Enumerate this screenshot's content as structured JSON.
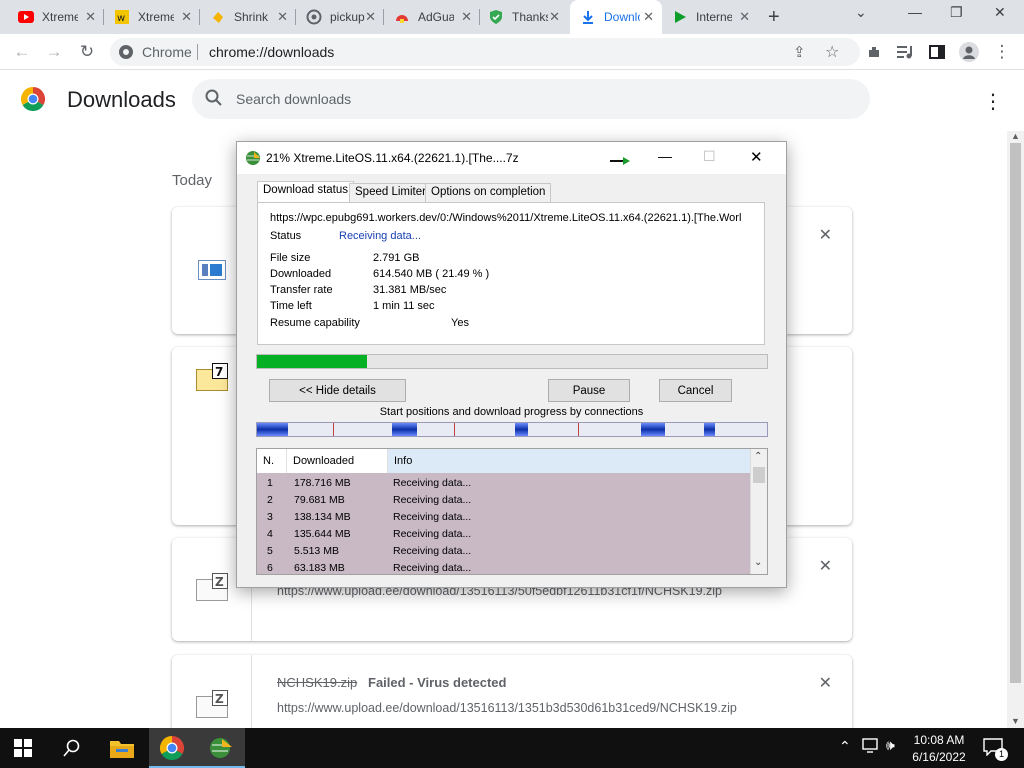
{
  "browser": {
    "tabs": [
      {
        "title": "Xtreme",
        "favicon": "youtube-icon"
      },
      {
        "title": "Xtreme",
        "favicon": "site-icon"
      },
      {
        "title": "Shrink",
        "favicon": "hand-icon"
      },
      {
        "title": "pickup",
        "favicon": "globe-icon"
      },
      {
        "title": "AdGuard",
        "favicon": "adguard-icon"
      },
      {
        "title": "Thanks",
        "favicon": "shield-check-icon"
      },
      {
        "title": "Downloads",
        "favicon": "download-icon",
        "active": true
      },
      {
        "title": "Internet",
        "favicon": "play-icon"
      }
    ],
    "omnibox": {
      "chip": "Chrome",
      "url": "chrome://downloads"
    }
  },
  "downloads_page": {
    "title": "Downloads",
    "search_placeholder": "Search downloads",
    "section": "Today",
    "items": [
      {
        "name": "",
        "status": "",
        "url": ""
      },
      {
        "name": "",
        "status": "",
        "url": ""
      },
      {
        "name": "",
        "status": "",
        "url": "https://www.upload.ee/download/13516113/50f5edbf12611b31cf1f/NCHSK19.zip"
      },
      {
        "name": "NCHSK19.zip",
        "status": "Failed - Virus detected",
        "url": "https://www.upload.ee/download/13516113/1351b3d530d61b31ced9/NCHSK19.zip"
      }
    ]
  },
  "idm": {
    "title": "21% Xtreme.LiteOS.11.x64.(22621.1).[The....7z",
    "tabs": [
      "Download status",
      "Speed Limiter",
      "Options on completion"
    ],
    "url": "https://wpc.epubg691.workers.dev/0:/Windows%2011/Xtreme.LiteOS.11.x64.(22621.1).[The.Worl",
    "status_label": "Status",
    "status_value": "Receiving data...",
    "fields": [
      {
        "label": "File size",
        "value": "2.791  GB"
      },
      {
        "label": "Downloaded",
        "value": "614.540  MB  ( 21.49 % )"
      },
      {
        "label": "Transfer rate",
        "value": "31.381  MB/sec"
      },
      {
        "label": "Time left",
        "value": "1 min 11 sec"
      },
      {
        "label": "Resume capability",
        "value": "Yes"
      }
    ],
    "progress": 0.2149,
    "buttons": {
      "hide": "<< Hide details",
      "pause": "Pause",
      "cancel": "Cancel"
    },
    "connections_label": "Start positions and download progress by connections",
    "table_headers": [
      "N.",
      "Downloaded",
      "Info"
    ],
    "connections": [
      {
        "n": "1",
        "downloaded": "178.716  MB",
        "info": "Receiving data..."
      },
      {
        "n": "2",
        "downloaded": "79.681  MB",
        "info": "Receiving data..."
      },
      {
        "n": "3",
        "downloaded": "138.134  MB",
        "info": "Receiving data..."
      },
      {
        "n": "4",
        "downloaded": "135.644  MB",
        "info": "Receiving data..."
      },
      {
        "n": "5",
        "downloaded": "5.513  MB",
        "info": "Receiving data..."
      },
      {
        "n": "6",
        "downloaded": "63.183  MB",
        "info": "Receiving data..."
      }
    ]
  },
  "taskbar": {
    "time": "10:08 AM",
    "date": "6/16/2022",
    "notifications": "1"
  },
  "colors": {
    "accent": "#1a73e8",
    "progress": "#06b025",
    "taskbar": "#101010"
  }
}
